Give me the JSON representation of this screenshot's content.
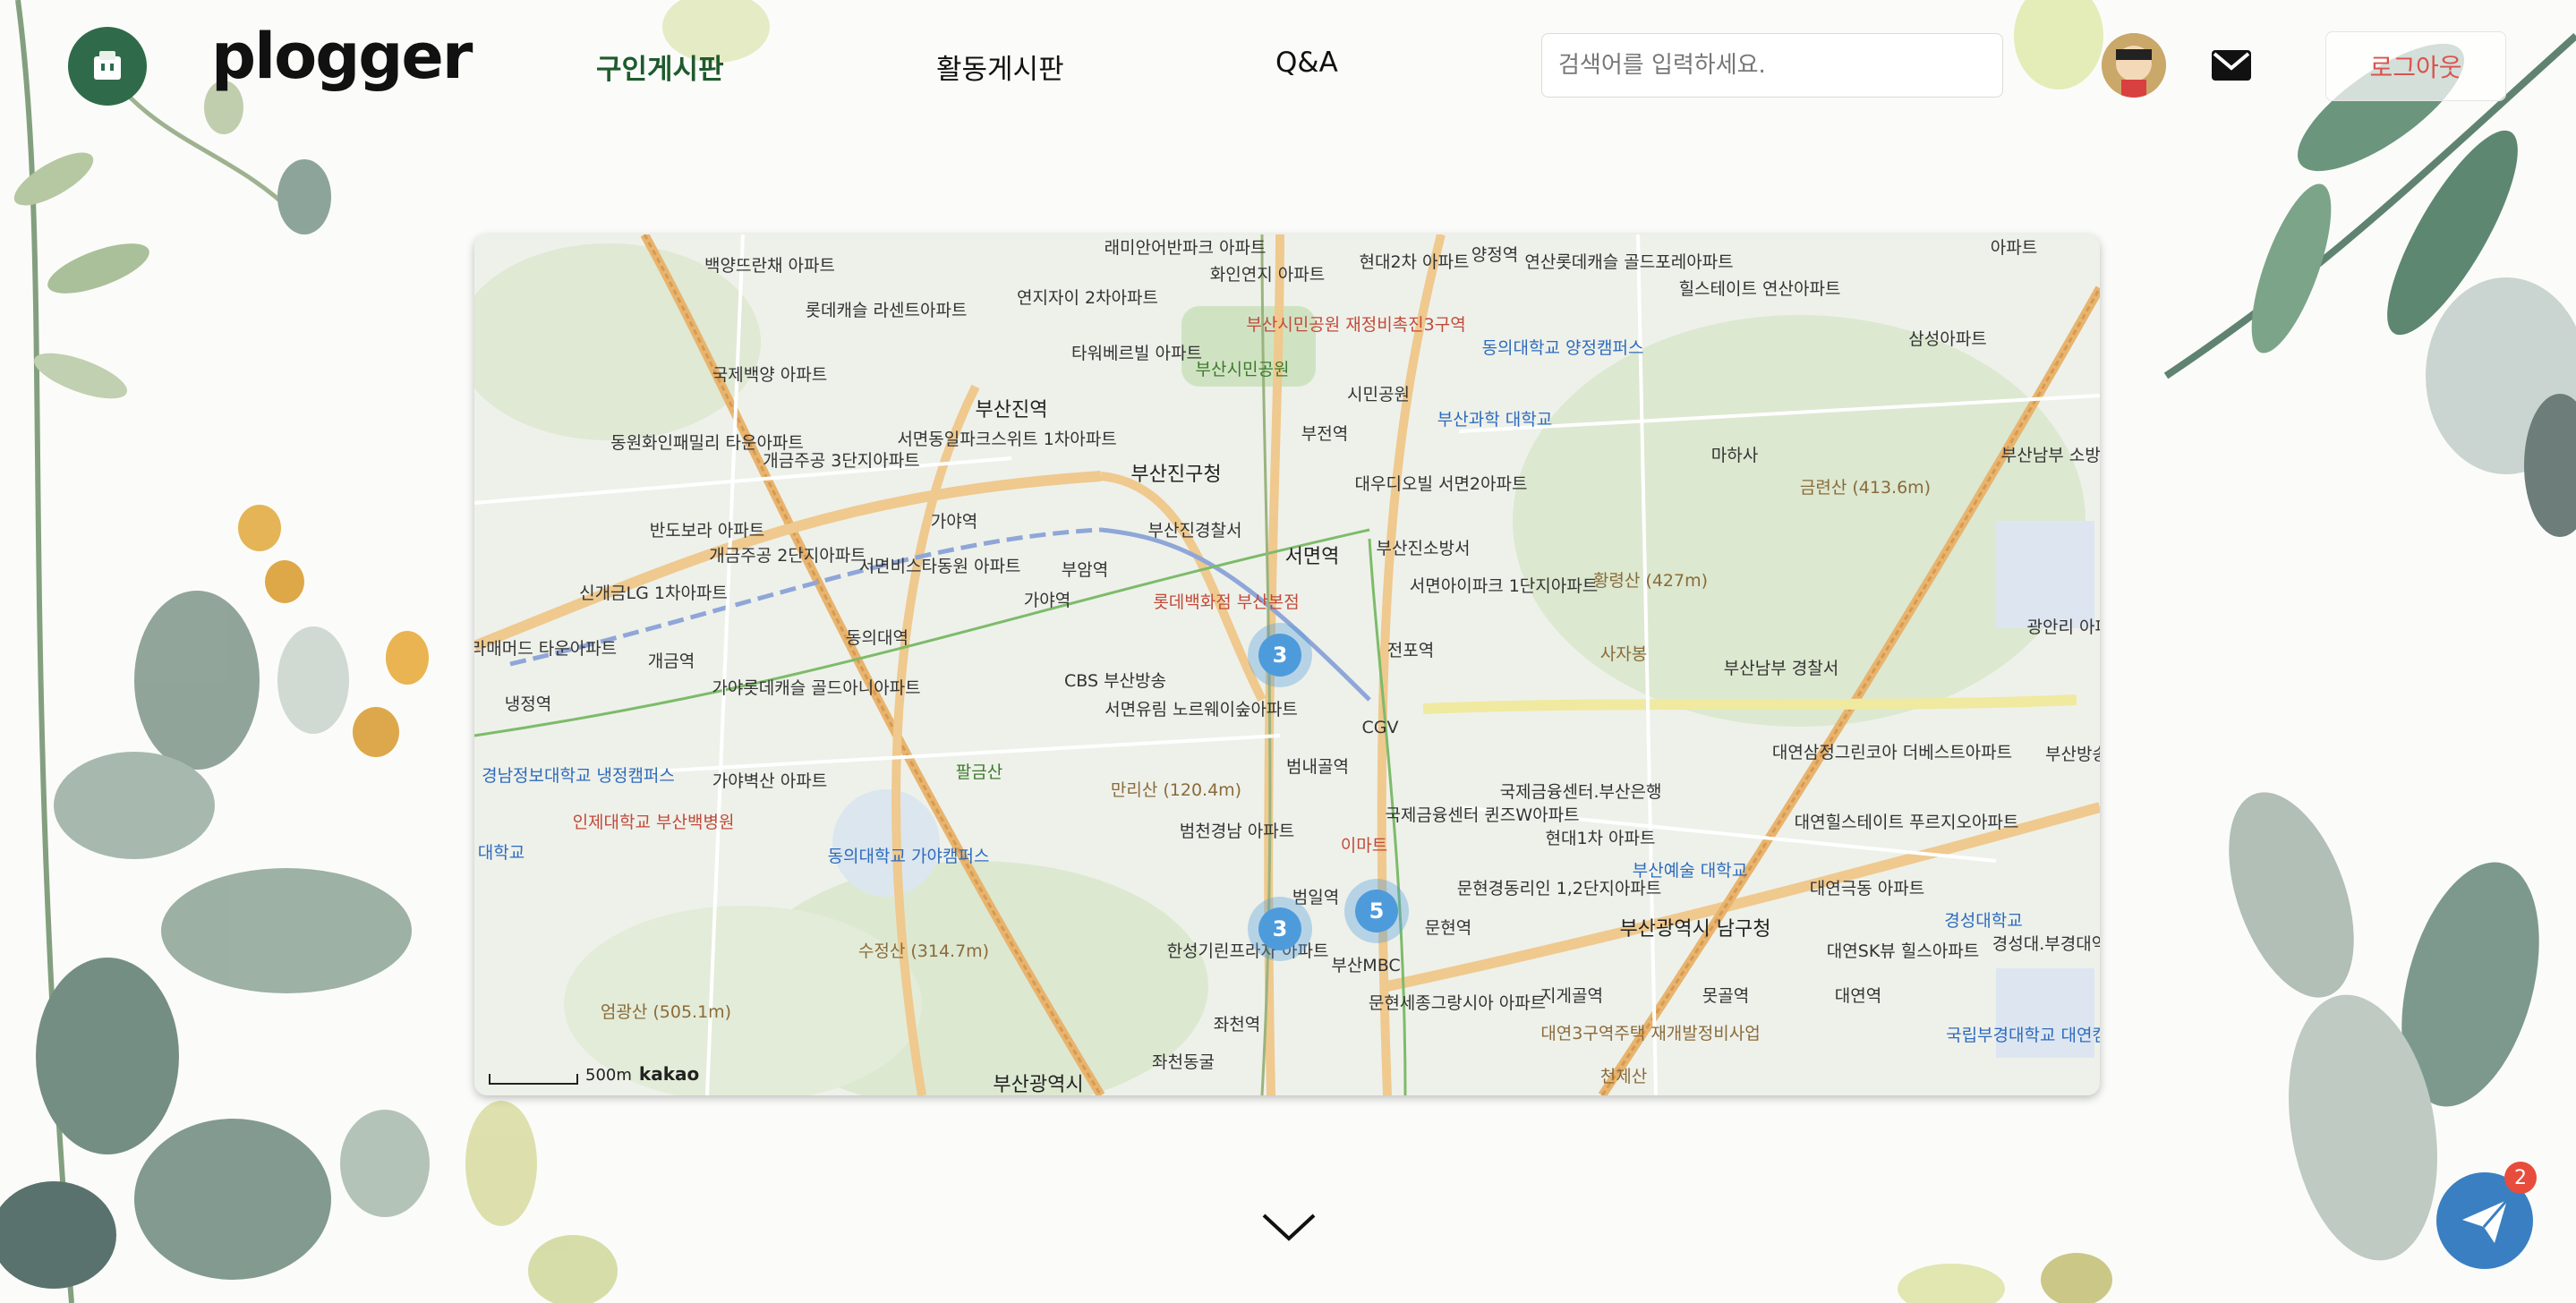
{
  "header": {
    "brand": "plogger",
    "nav": [
      {
        "label": "구인게시판",
        "active": true
      },
      {
        "label": "활동게시판",
        "active": false
      },
      {
        "label": "Q&A",
        "active": false
      }
    ],
    "search_placeholder": "검색어를 입력하세요.",
    "logout_label": "로그아웃"
  },
  "map": {
    "clusters": [
      {
        "count": "3"
      },
      {
        "count": "5"
      },
      {
        "count": "3"
      }
    ],
    "scale_label": "500m",
    "attribution": "kakao",
    "labels": [
      "래미안어반파크 아파트",
      "화인연지 아파트",
      "현대2차 아파트",
      "양정역",
      "연산롯데캐슬 골드포레아파트",
      "아파트",
      "백양뜨란채 아파트",
      "연지자이 2차아파트",
      "부산시민공원 재정비촉진3구역",
      "힐스테이트 연산아파트",
      "롯데캐슬 라센트아파트",
      "국제백양 아파트",
      "타워베르빌 아파트",
      "부산시민공원",
      "동의대학교 양정캠퍼스",
      "삼성아파트",
      "부산진역",
      "시민공원",
      "부산과학 대학교",
      "동원화인패밀리 타운아파트",
      "서면동일파크스위트 1차아파트",
      "부전역",
      "마하사",
      "부산남부 소방서",
      "개금주공 3단지아파트",
      "부산진구청",
      "금련산 (413.6m)",
      "가야역",
      "부산진경찰서",
      "대우디오빌 서면2아파트",
      "반도보라 아파트",
      "개금주공 2단지아파트",
      "서면비스타동원 아파트",
      "부암역",
      "서면역",
      "부산진소방서",
      "신개금LG 1차아파트",
      "가야역",
      "롯데백화점 부산본점",
      "황령산 (427m)",
      "서면아이파크 1단지아파트",
      "동의대역",
      "전포역",
      "사자봉",
      "광안리 아파트",
      "도보라매머드 타운아파트",
      "개금역",
      "부산남부 경찰서",
      "냉정역",
      "가야롯데캐슬 골드아니아파트",
      "CBS 부산방송",
      "서면유림 노르웨이숲아파트",
      "CGV",
      "대연삼정그린코아 더베스트아파트",
      "부산방송",
      "경남정보대학교 냉정캠퍼스",
      "가야벽산 아파트",
      "팔금산",
      "만리산 (120.4m)",
      "범내골역",
      "국제금융센터.부산은행",
      "인제대학교 부산백병원",
      "범천경남 아파트",
      "국제금융센터 퀸즈W아파트",
      "대연힐스테이트 푸르지오아파트",
      "대학교",
      "동의대학교 가야캠퍼스",
      "이마트",
      "현대1차 아파트",
      "부산예술 대학교",
      "범일역",
      "문현경동리인 1,2단지아파트",
      "대연극동 아파트",
      "경성대학교",
      "수정산 (314.7m)",
      "한성기린프라자 아파트",
      "부산MBC",
      "문현역",
      "부산광역시 남구청",
      "대연SK뷰 힐스아파트",
      "경성대.부경대역",
      "엄광산 (505.1m)",
      "좌천역",
      "문현세종그랑시아 아파트",
      "지게골역",
      "못골역",
      "대연역",
      "대연3구역주택 재개발정비사업",
      "국립부경대학교 대연캠퍼스",
      "좌천동굴",
      "부산광역시",
      "천제산"
    ]
  },
  "chat": {
    "badge": "2"
  }
}
